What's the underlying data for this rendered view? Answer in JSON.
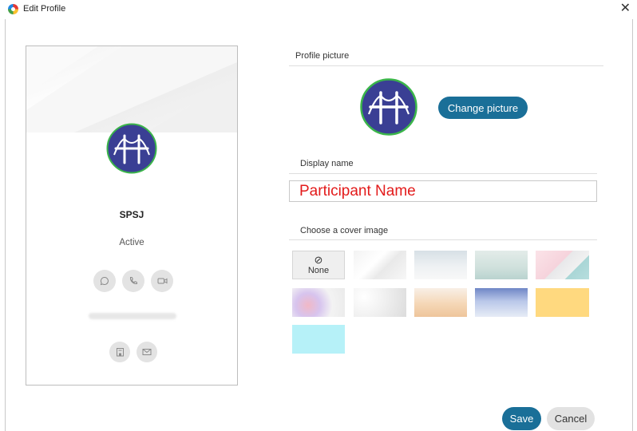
{
  "window": {
    "title": "Edit Profile",
    "close_label": "✕"
  },
  "preview_card": {
    "name": "SPSJ",
    "status": "Active",
    "action_icons": [
      "chat-icon",
      "phone-icon",
      "video-icon"
    ],
    "contact_icons": [
      "building-icon",
      "mail-icon"
    ]
  },
  "sections": {
    "profile_picture": "Profile picture",
    "display_name": "Display name",
    "cover_image": "Choose a cover image"
  },
  "buttons": {
    "change_picture": "Change picture",
    "save": "Save",
    "cancel": "Cancel"
  },
  "display_name_field": {
    "value": "Participant Name"
  },
  "cover_options": {
    "none_label": "None",
    "none_icon": "⊘"
  },
  "colors": {
    "accent": "#1a6f98",
    "avatar_bg": "#3a3f94",
    "avatar_ring": "#3bb54a",
    "name_text": "#e31b1b"
  }
}
